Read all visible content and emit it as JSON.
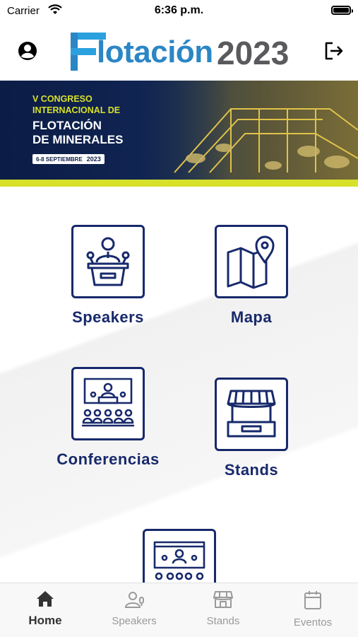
{
  "status_bar": {
    "carrier": "Carrier",
    "time": "6:36 p.m."
  },
  "header": {
    "logo_word": "lotación",
    "logo_year": "2023"
  },
  "banner": {
    "line1a": "V CONGRESO",
    "line1b": "INTERNACIONAL DE",
    "line2a": "FLOTACIÓN",
    "line2b": "DE MINERALES",
    "date_days": "6-8 SEPTIEMBRE",
    "date_year": "2023"
  },
  "menu": {
    "speakers": "Speakers",
    "mapa": "Mapa",
    "conferencias": "Conferencias",
    "stands": "Stands"
  },
  "tabs": {
    "home": "Home",
    "speakers": "Speakers",
    "stands": "Stands",
    "eventos": "Eventos"
  },
  "colors": {
    "navy": "#17296b",
    "accent": "#d7e12a",
    "logo_blue": "#2b86c5"
  }
}
